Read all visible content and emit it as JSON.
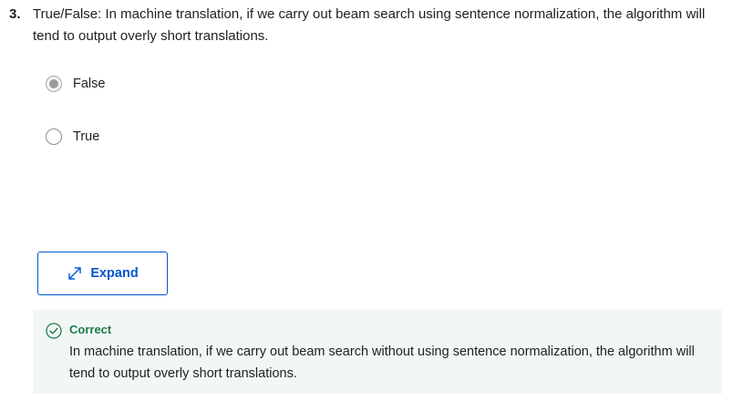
{
  "question": {
    "number": "3.",
    "text": "True/False: In machine translation, if we carry out beam search using sentence normalization, the algorithm will tend to output overly short translations."
  },
  "options": [
    {
      "label": "False",
      "selected": true
    },
    {
      "label": "True",
      "selected": false
    }
  ],
  "expand_button": {
    "label": "Expand",
    "icon": "expand-arrows-icon"
  },
  "feedback": {
    "status": "Correct",
    "icon": "check-circle-icon",
    "text": "In machine translation, if we carry out beam search without using sentence normalization, the algorithm will tend to output overly short translations."
  },
  "colors": {
    "accent": "#0056d2",
    "success": "#1d7a4a",
    "feedback_bg": "#f1f7f4"
  }
}
